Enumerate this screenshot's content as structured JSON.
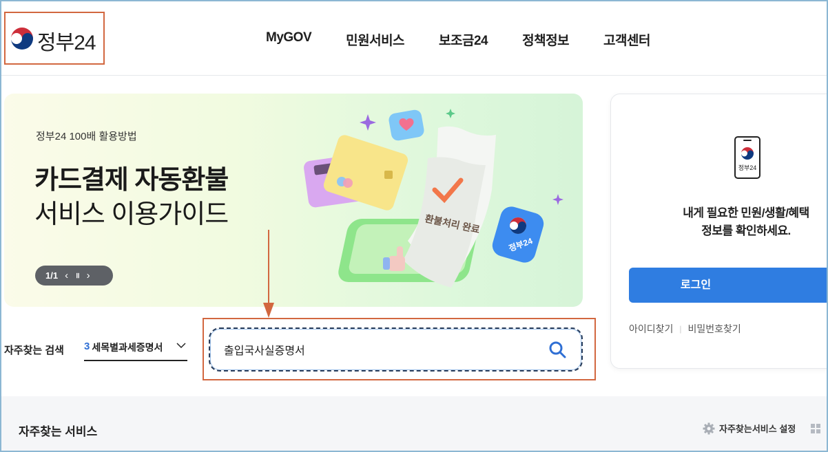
{
  "header": {
    "logo_text": "정부24",
    "nav": [
      "MyGOV",
      "민원서비스",
      "보조금24",
      "정책정보",
      "고객센터"
    ]
  },
  "banner": {
    "subtitle": "정부24 100배 활용방법",
    "title_bold": "카드결제 자동환불",
    "title_regular": "서비스 이용가이드",
    "pager_count": "1/1",
    "art_text": "환불처리 완료",
    "art_badge_text": "정부24"
  },
  "login": {
    "phone_text": "정부24",
    "message_line1": "내게 필요한 민원/생활/혜택",
    "message_line2": "정보를 확인하세요.",
    "login_button": "로그인",
    "find_id": "아이디찾기",
    "find_password": "비밀번호찾기"
  },
  "frequent_search": {
    "label": "자주찾는 검색",
    "rank": "3",
    "selected": "세목별과세증명서"
  },
  "search": {
    "value": "출입국사실증명서"
  },
  "bottom": {
    "title": "자주찾는 서비스",
    "setting": "자주찾는서비스 설정"
  },
  "colors": {
    "accent_blue": "#2f7de1",
    "annotation_orange": "#d2673f"
  }
}
